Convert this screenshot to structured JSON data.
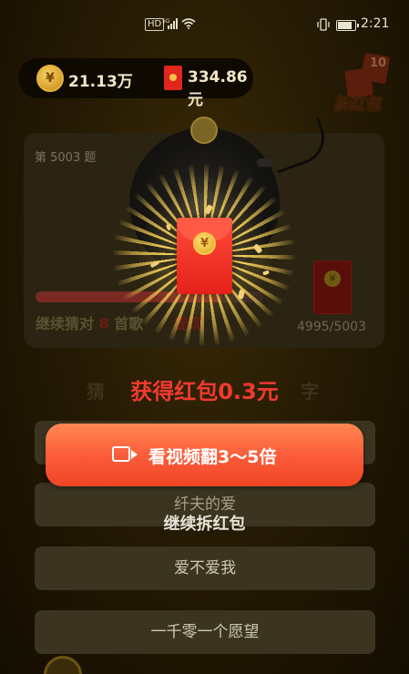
{
  "status_bar": {
    "hd": "HD",
    "network": "5G",
    "time": "2:21",
    "icons": [
      "signal-icon",
      "wifi-icon",
      "vibrate-icon",
      "battery-icon"
    ]
  },
  "wallet": {
    "coin_symbol": "¥",
    "coins": "21.13万",
    "cash": "334.86元"
  },
  "chai": {
    "count": "10",
    "label": "拆红包"
  },
  "question": {
    "number": "第 5003 题",
    "hint_prefix": "继续猜对 ",
    "hint_num": "8",
    "hint_mid": " 首歌",
    "hint_suffix": "提现",
    "progress_current": 4995,
    "progress_total": 5003,
    "progress_text": "4995/5003",
    "progress_fill_fraction": 0.82
  },
  "guess": {
    "left": "猜",
    "right": "字"
  },
  "reward": {
    "title": "获得红包0.3元",
    "coin_symbol": "¥"
  },
  "options": [
    "",
    "纤夫的爱",
    "爱不爱我",
    "一千零一个愿望"
  ],
  "video_button": {
    "label": "看视频翻3～5倍"
  },
  "continue_label": "继续拆红包",
  "colors": {
    "accent_red": "#f23a2e",
    "button_orange": "#fa5a38",
    "gold": "#f6d264"
  }
}
